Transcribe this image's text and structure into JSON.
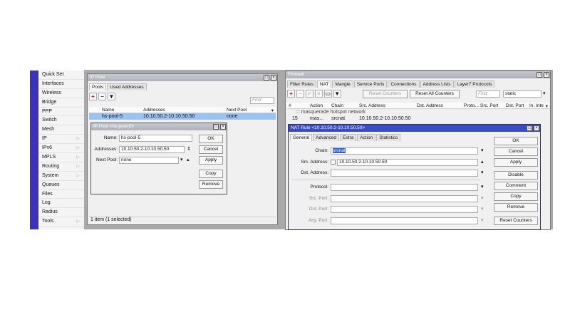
{
  "menu": [
    {
      "label": "Quick Set"
    },
    {
      "label": "Interfaces"
    },
    {
      "label": "Wireless"
    },
    {
      "label": "Bridge"
    },
    {
      "label": "PPP"
    },
    {
      "label": "Switch"
    },
    {
      "label": "Mesh"
    },
    {
      "label": "IP",
      "sub": true
    },
    {
      "label": "IPv6",
      "sub": true
    },
    {
      "label": "MPLS",
      "sub": true
    },
    {
      "label": "Routing",
      "sub": true
    },
    {
      "label": "System",
      "sub": true
    },
    {
      "label": "Queues"
    },
    {
      "label": "Files"
    },
    {
      "label": "Log"
    },
    {
      "label": "Radius"
    },
    {
      "label": "Tools",
      "sub": true
    }
  ],
  "ippool": {
    "title": "IP Pool",
    "tabs": [
      "Pools",
      "Used Addresses"
    ],
    "find": "Find",
    "columns": [
      "Name",
      "Addresses",
      "Next Pool"
    ],
    "row": {
      "name": "hs-pool-5",
      "addresses": "10.10.50.2-10.10.50.50",
      "next": "none"
    },
    "status": "1 item (1 selected)",
    "dialog": {
      "title": "IP Pool <hs-pool-5>",
      "name_label": "Name:",
      "name": "hs-pool-5",
      "addr_label": "Addresses:",
      "addresses": "10.10.50.2-10.10.50.50",
      "next_label": "Next Pool:",
      "next": "none",
      "buttons": [
        "OK",
        "Cancel",
        "Apply",
        "Copy",
        "Remove"
      ]
    }
  },
  "firewall": {
    "title": "Firewall",
    "tabs": [
      "Filter Rules",
      "NAT",
      "Mangle",
      "Service Ports",
      "Connections",
      "Address Lists",
      "Layer7 Protocols"
    ],
    "reset": "Reset Counters",
    "reset_all": "Reset All Counters",
    "find": "Find",
    "filter": "static",
    "columns": [
      "#",
      "Action",
      "Chain",
      "Src. Address",
      "Dst. Address",
      "Proto...",
      "Src. Port",
      "Dst. Port",
      "In. Inte"
    ],
    "comment": "::: masquerade hotspot network",
    "row": {
      "num": "15",
      "action": "mas...",
      "chain": "srcnat",
      "src": "10.10.50.2-10.10.50.50"
    }
  },
  "nat": {
    "title": "NAT Rule <10.10.50.2-10.10.50.50>",
    "tabs": [
      "General",
      "Advanced",
      "Extra",
      "Action",
      "Statistics"
    ],
    "chain_label": "Chain:",
    "chain": "srcnat",
    "src_label": "Src. Address:",
    "src": "10.10.50.2-10.10.50.50",
    "dst_label": "Dst. Address:",
    "proto_label": "Protocol:",
    "sport_label": "Src. Port:",
    "dport_label": "Dst. Port:",
    "anyport_label": "Any. Port:",
    "buttons": [
      "OK",
      "Cancel",
      "Apply",
      "Disable",
      "Comment",
      "Copy",
      "Remove",
      "Reset Counters"
    ]
  }
}
